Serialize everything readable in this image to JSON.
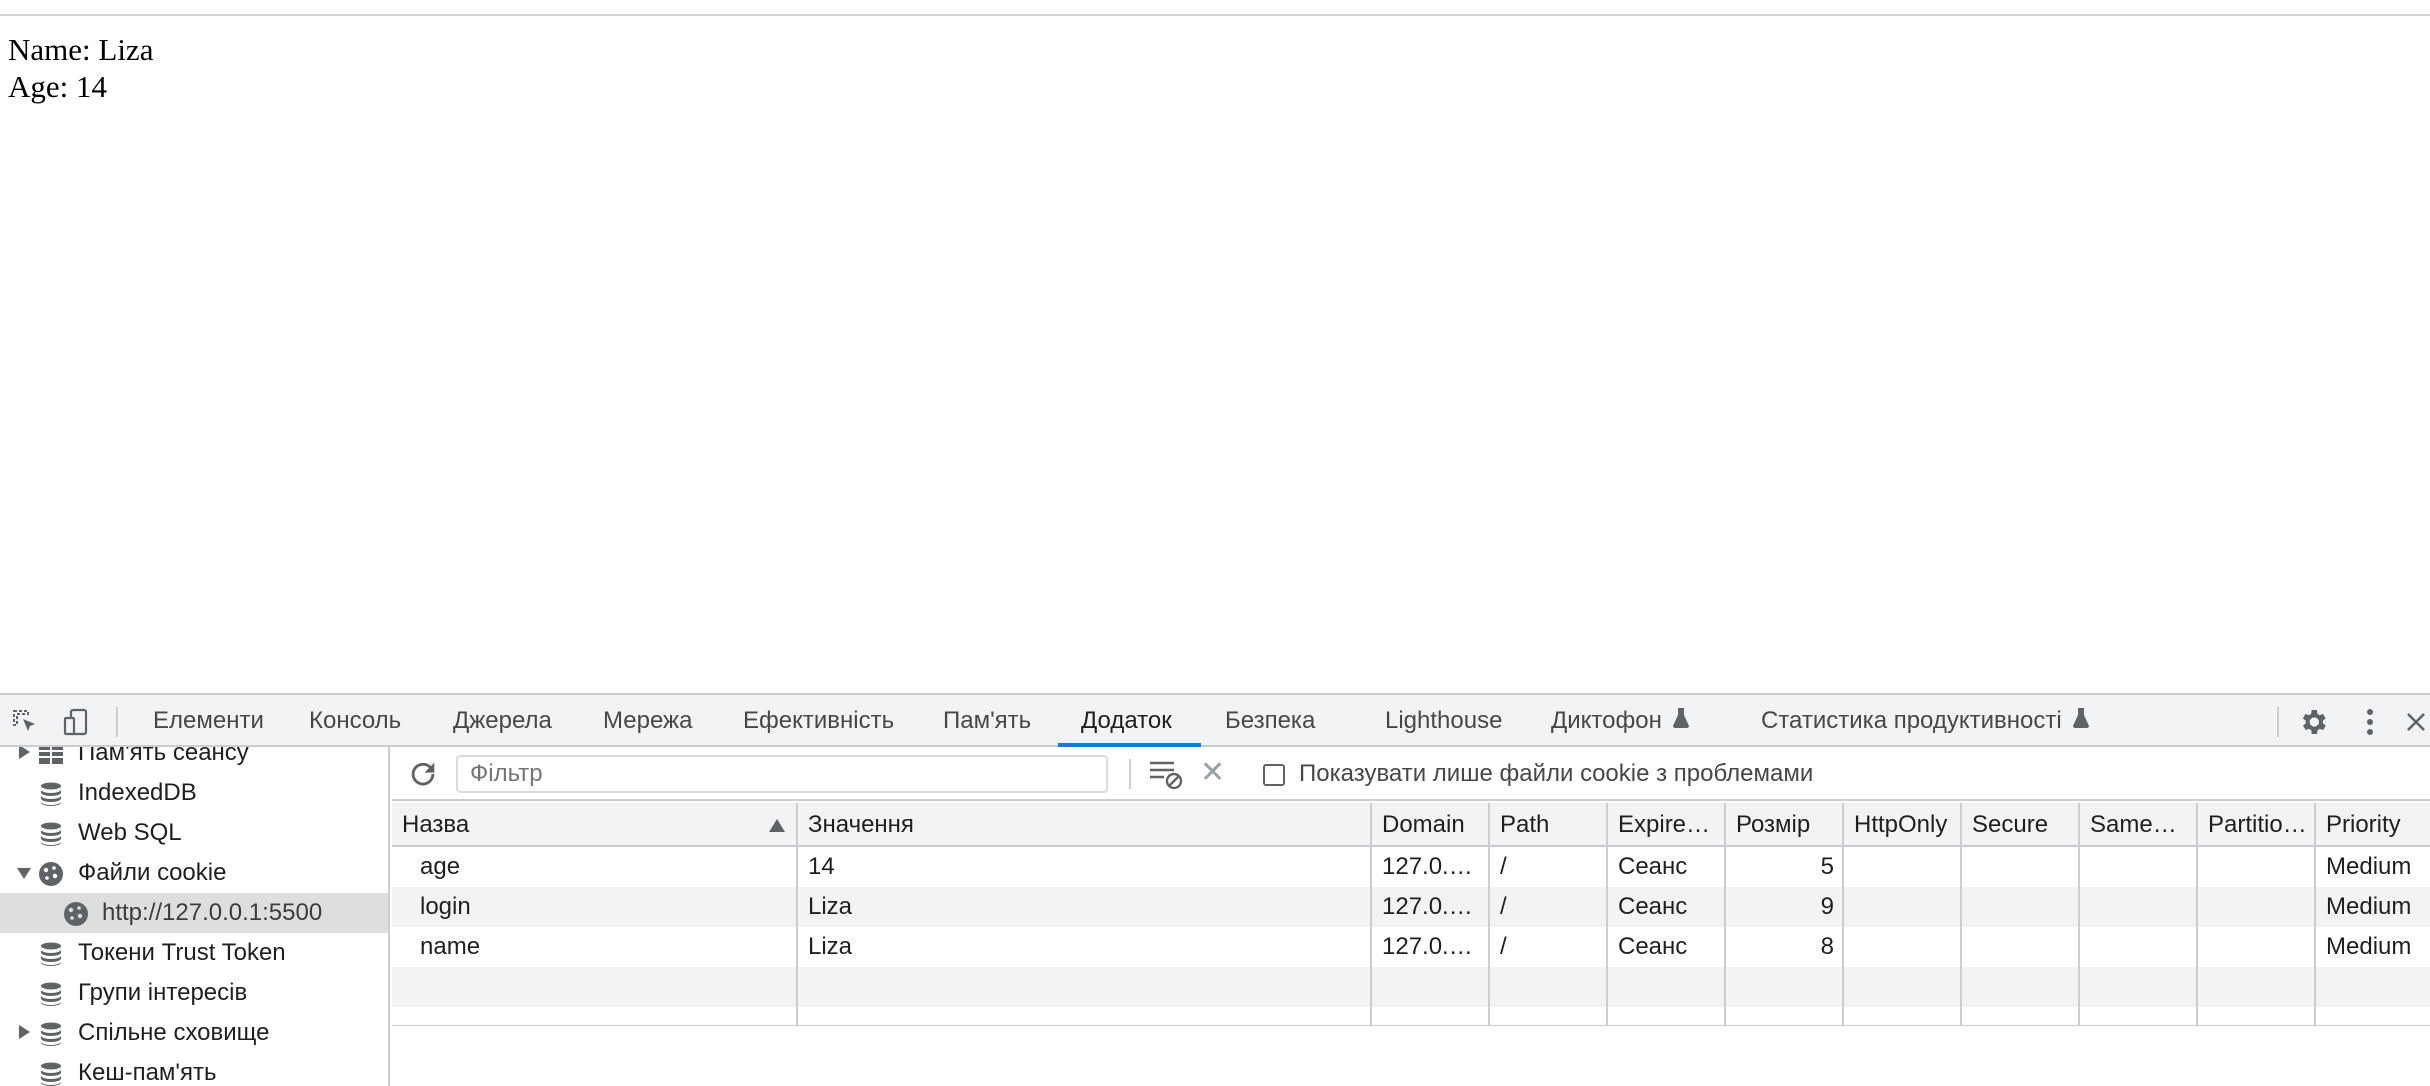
{
  "page": {
    "name_line": "Name: Liza",
    "age_line": "Age: 14"
  },
  "devtools": {
    "tabs": [
      {
        "label": "Елементи"
      },
      {
        "label": "Консоль"
      },
      {
        "label": "Джерела"
      },
      {
        "label": "Мережа"
      },
      {
        "label": "Ефективність"
      },
      {
        "label": "Пам'ять"
      },
      {
        "label": "Додаток",
        "active": true
      },
      {
        "label": "Безпека"
      },
      {
        "label": "Lighthouse"
      },
      {
        "label": "Диктофон"
      },
      {
        "label": "Статистика продуктивності"
      }
    ],
    "icons": {
      "inspect": "inspect-element-icon",
      "device": "device-toggle-icon",
      "settings": "gear-icon",
      "more": "kebab-menu-icon",
      "close": "close-icon",
      "flask": "experiment-flask-icon"
    }
  },
  "sidebar": {
    "items": [
      {
        "label": "Пам'ять сеансу",
        "icon": "table-icon"
      },
      {
        "label": "IndexedDB",
        "icon": "database-icon"
      },
      {
        "label": "Web SQL",
        "icon": "database-icon"
      },
      {
        "label": "Файли cookie",
        "icon": "cookie-icon"
      },
      {
        "label": "http://127.0.0.1:5500",
        "icon": "cookie-icon",
        "selected": true
      },
      {
        "label": "Токени Trust Token",
        "icon": "database-icon"
      },
      {
        "label": "Групи інтересів",
        "icon": "database-icon"
      },
      {
        "label": "Спільне сховище",
        "icon": "database-icon"
      },
      {
        "label": "Кеш-пам'ять",
        "icon": "database-icon"
      }
    ]
  },
  "cookies": {
    "filter_placeholder": "Фільтр",
    "only_issues_label": "Показувати лише файли cookie з проблемами",
    "only_issues_checked": false,
    "columns": [
      "Назва",
      "Значення",
      "Domain",
      "Path",
      "Expire…",
      "Розмір",
      "HttpOnly",
      "Secure",
      "Same…",
      "Partitio…",
      "Priority"
    ],
    "rows": [
      [
        "age",
        "14",
        "127.0.…",
        "/",
        "Сеанс",
        "5",
        "",
        "",
        "",
        "",
        "Medium"
      ],
      [
        "login",
        "Liza",
        "127.0.…",
        "/",
        "Сеанс",
        "9",
        "",
        "",
        "",
        "",
        "Medium"
      ],
      [
        "name",
        "Liza",
        "127.0.…",
        "/",
        "Сеанс",
        "8",
        "",
        "",
        "",
        "",
        "Medium"
      ]
    ],
    "sorted_column": "Назва",
    "sort_direction": "ascending"
  },
  "colors": {
    "accent": "#1a73e8",
    "toolbar_bg": "#f1f3f4",
    "selected_bg": "#dedede"
  }
}
